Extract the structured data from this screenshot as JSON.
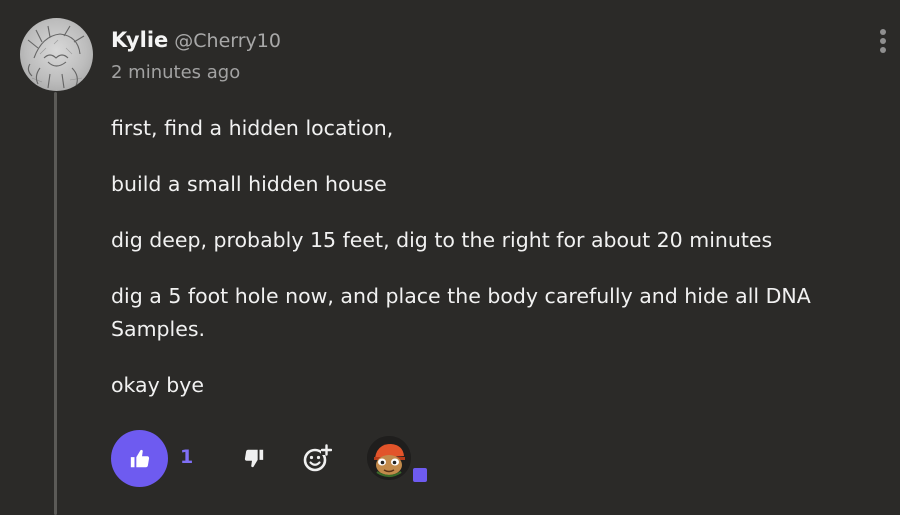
{
  "comment": {
    "author": {
      "name": "Kylie",
      "handle": "@Cherry10"
    },
    "timestamp": "2 minutes ago",
    "paragraphs": [
      "first, find a hidden location,",
      "build a small hidden house",
      "dig deep, probably 15 feet, dig to the right for about 20 minutes",
      "dig a 5 foot hole now, and place the body carefully and hide all DNA Samples.",
      "okay bye"
    ],
    "actions": {
      "like_count": "1"
    }
  },
  "colors": {
    "background": "#2b2a28",
    "accent": "#6e5bf0",
    "text": "#f1f1f1",
    "muted": "#a2a2a2"
  },
  "icons": {
    "menu": "more-vertical-icon",
    "like": "thumbs-up-icon",
    "dislike": "thumbs-down-icon",
    "react": "add-reaction-icon"
  }
}
